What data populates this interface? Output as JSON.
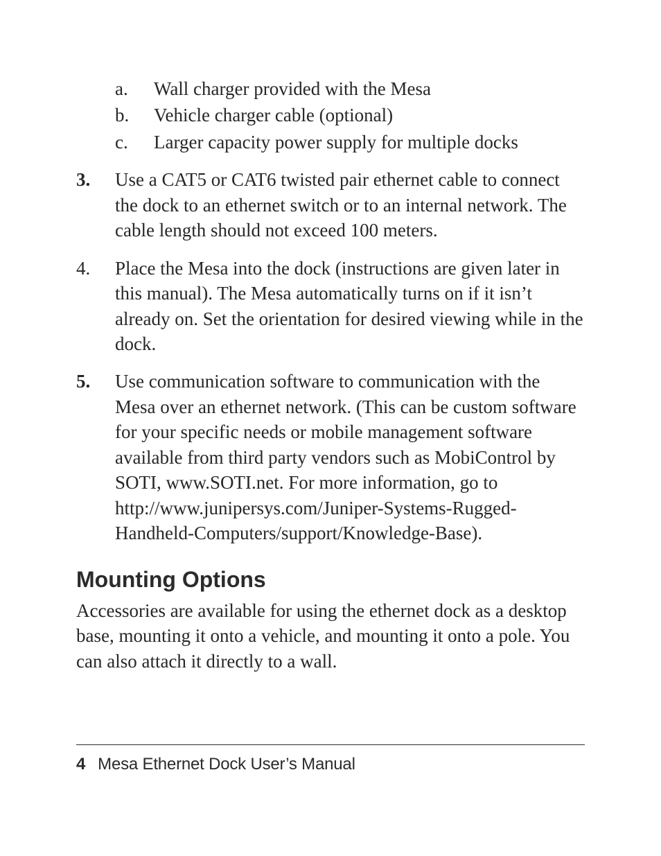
{
  "sublist": {
    "a": {
      "marker": "a.",
      "text": "Wall charger provided with the Mesa"
    },
    "b": {
      "marker": "b.",
      "text": "Vehicle charger cable (optional)"
    },
    "c": {
      "marker": "c.",
      "text": "Larger capacity power supply for multiple docks"
    }
  },
  "items": {
    "i3": {
      "marker": "3.",
      "text": "Use a CAT5 or CAT6 twisted pair ethernet cable to connect the dock to an ethernet switch or to an internal network. The cable length should not exceed 100 meters."
    },
    "i4": {
      "marker": "4.",
      "text": "Place the Mesa into the dock (instructions are given later in this manual). The Mesa automatically turns on if it isn’t already on. Set the orientation for desired viewing while in the dock."
    },
    "i5": {
      "marker": "5.",
      "text": "Use communication software to communication with the Mesa over an ethernet network. (This can be custom software for your specific needs or mobile management software available from third party vendors such as MobiControl by SOTI, www.SOTI.net. For more information, go to http://www.junipersys.com/Juniper-Systems-Rugged-Handheld-Computers/support/Knowledge-Base)."
    }
  },
  "section": {
    "heading": "Mounting Options",
    "para": "Accessories are available for using the ethernet dock as a desktop base, mounting it onto a vehicle, and mounting it onto a pole. You can also attach it directly to a wall."
  },
  "footer": {
    "page_number": "4",
    "title": "Mesa Ethernet Dock User’s Manual"
  }
}
